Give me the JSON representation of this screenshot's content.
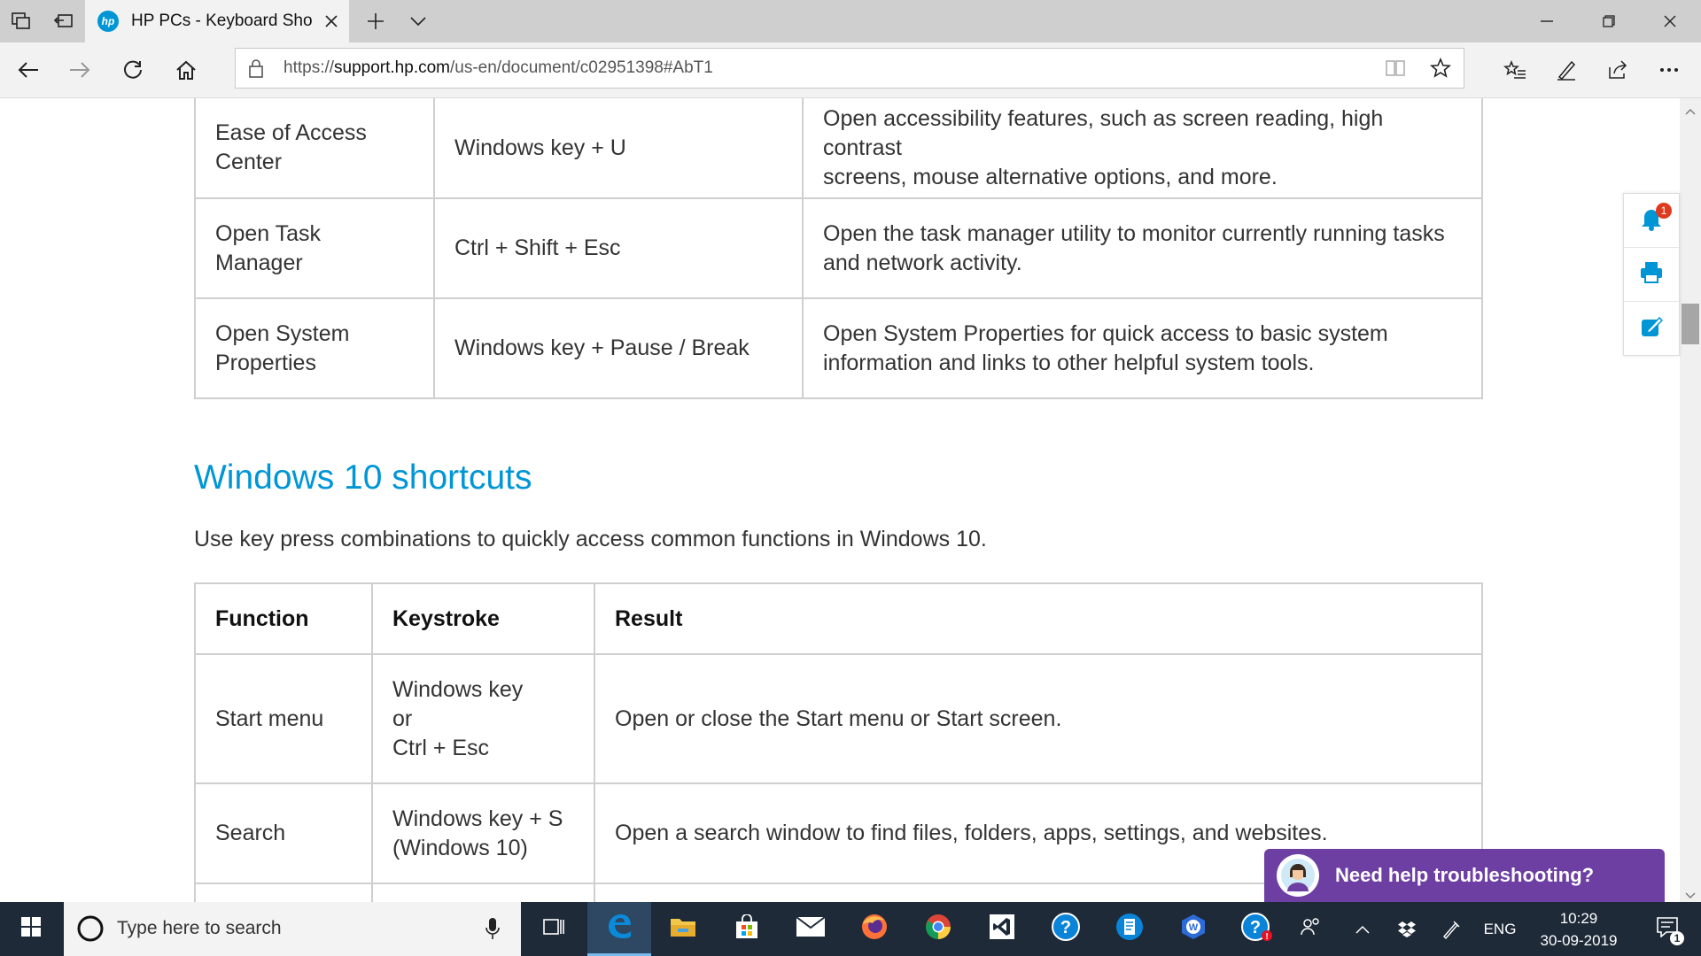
{
  "browser": {
    "tab_title": "HP PCs - Keyboard Shortcuts",
    "tab_title_display": "HP PCs - Keyboard Sho",
    "url_prefix": "https://",
    "url_domain": "support.hp.com",
    "url_path": "/us-en/document/c02951398#AbT1"
  },
  "table1": {
    "rows": [
      {
        "function": [
          "Ease of Access",
          "Center"
        ],
        "keystroke": "Windows key + U",
        "result": [
          "Open accessibility features, such as screen reading, high contrast",
          "screens, mouse alternative options, and more."
        ]
      },
      {
        "function": [
          "Open Task Manager"
        ],
        "keystroke": "Ctrl + Shift + Esc",
        "result": [
          "Open the task manager utility to monitor currently running tasks",
          "and network activity."
        ]
      },
      {
        "function": [
          "Open System",
          "Properties"
        ],
        "keystroke": "Windows key + Pause / Break",
        "result": [
          "Open System Properties for quick access to basic system",
          "information and links to other helpful system tools."
        ]
      }
    ]
  },
  "section": {
    "heading": "Windows 10 shortcuts",
    "intro": "Use key press combinations to quickly access common functions in Windows 10."
  },
  "table2": {
    "headers": [
      "Function",
      "Keystroke",
      "Result"
    ],
    "rows": [
      {
        "function": "Start menu",
        "keystroke": [
          "Windows key",
          "or",
          "Ctrl + Esc"
        ],
        "result": "Open or close the Start menu or Start screen."
      },
      {
        "function": "Search",
        "keystroke": [
          "Windows key + S",
          "(Windows 10)"
        ],
        "result": "Open a search window to find files, folders, apps, settings, and websites."
      }
    ]
  },
  "tools": {
    "notification_count": "1"
  },
  "chat": {
    "label": "Need help troubleshooting?"
  },
  "taskbar": {
    "search_placeholder": "Type here to search",
    "language": "ENG",
    "time": "10:29",
    "date": "30-09-2019",
    "notification_count": "1"
  },
  "colors": {
    "accent": "#0096d6",
    "chat_bg": "#6e3fa3",
    "taskbar_bg": "#1e2a38"
  }
}
